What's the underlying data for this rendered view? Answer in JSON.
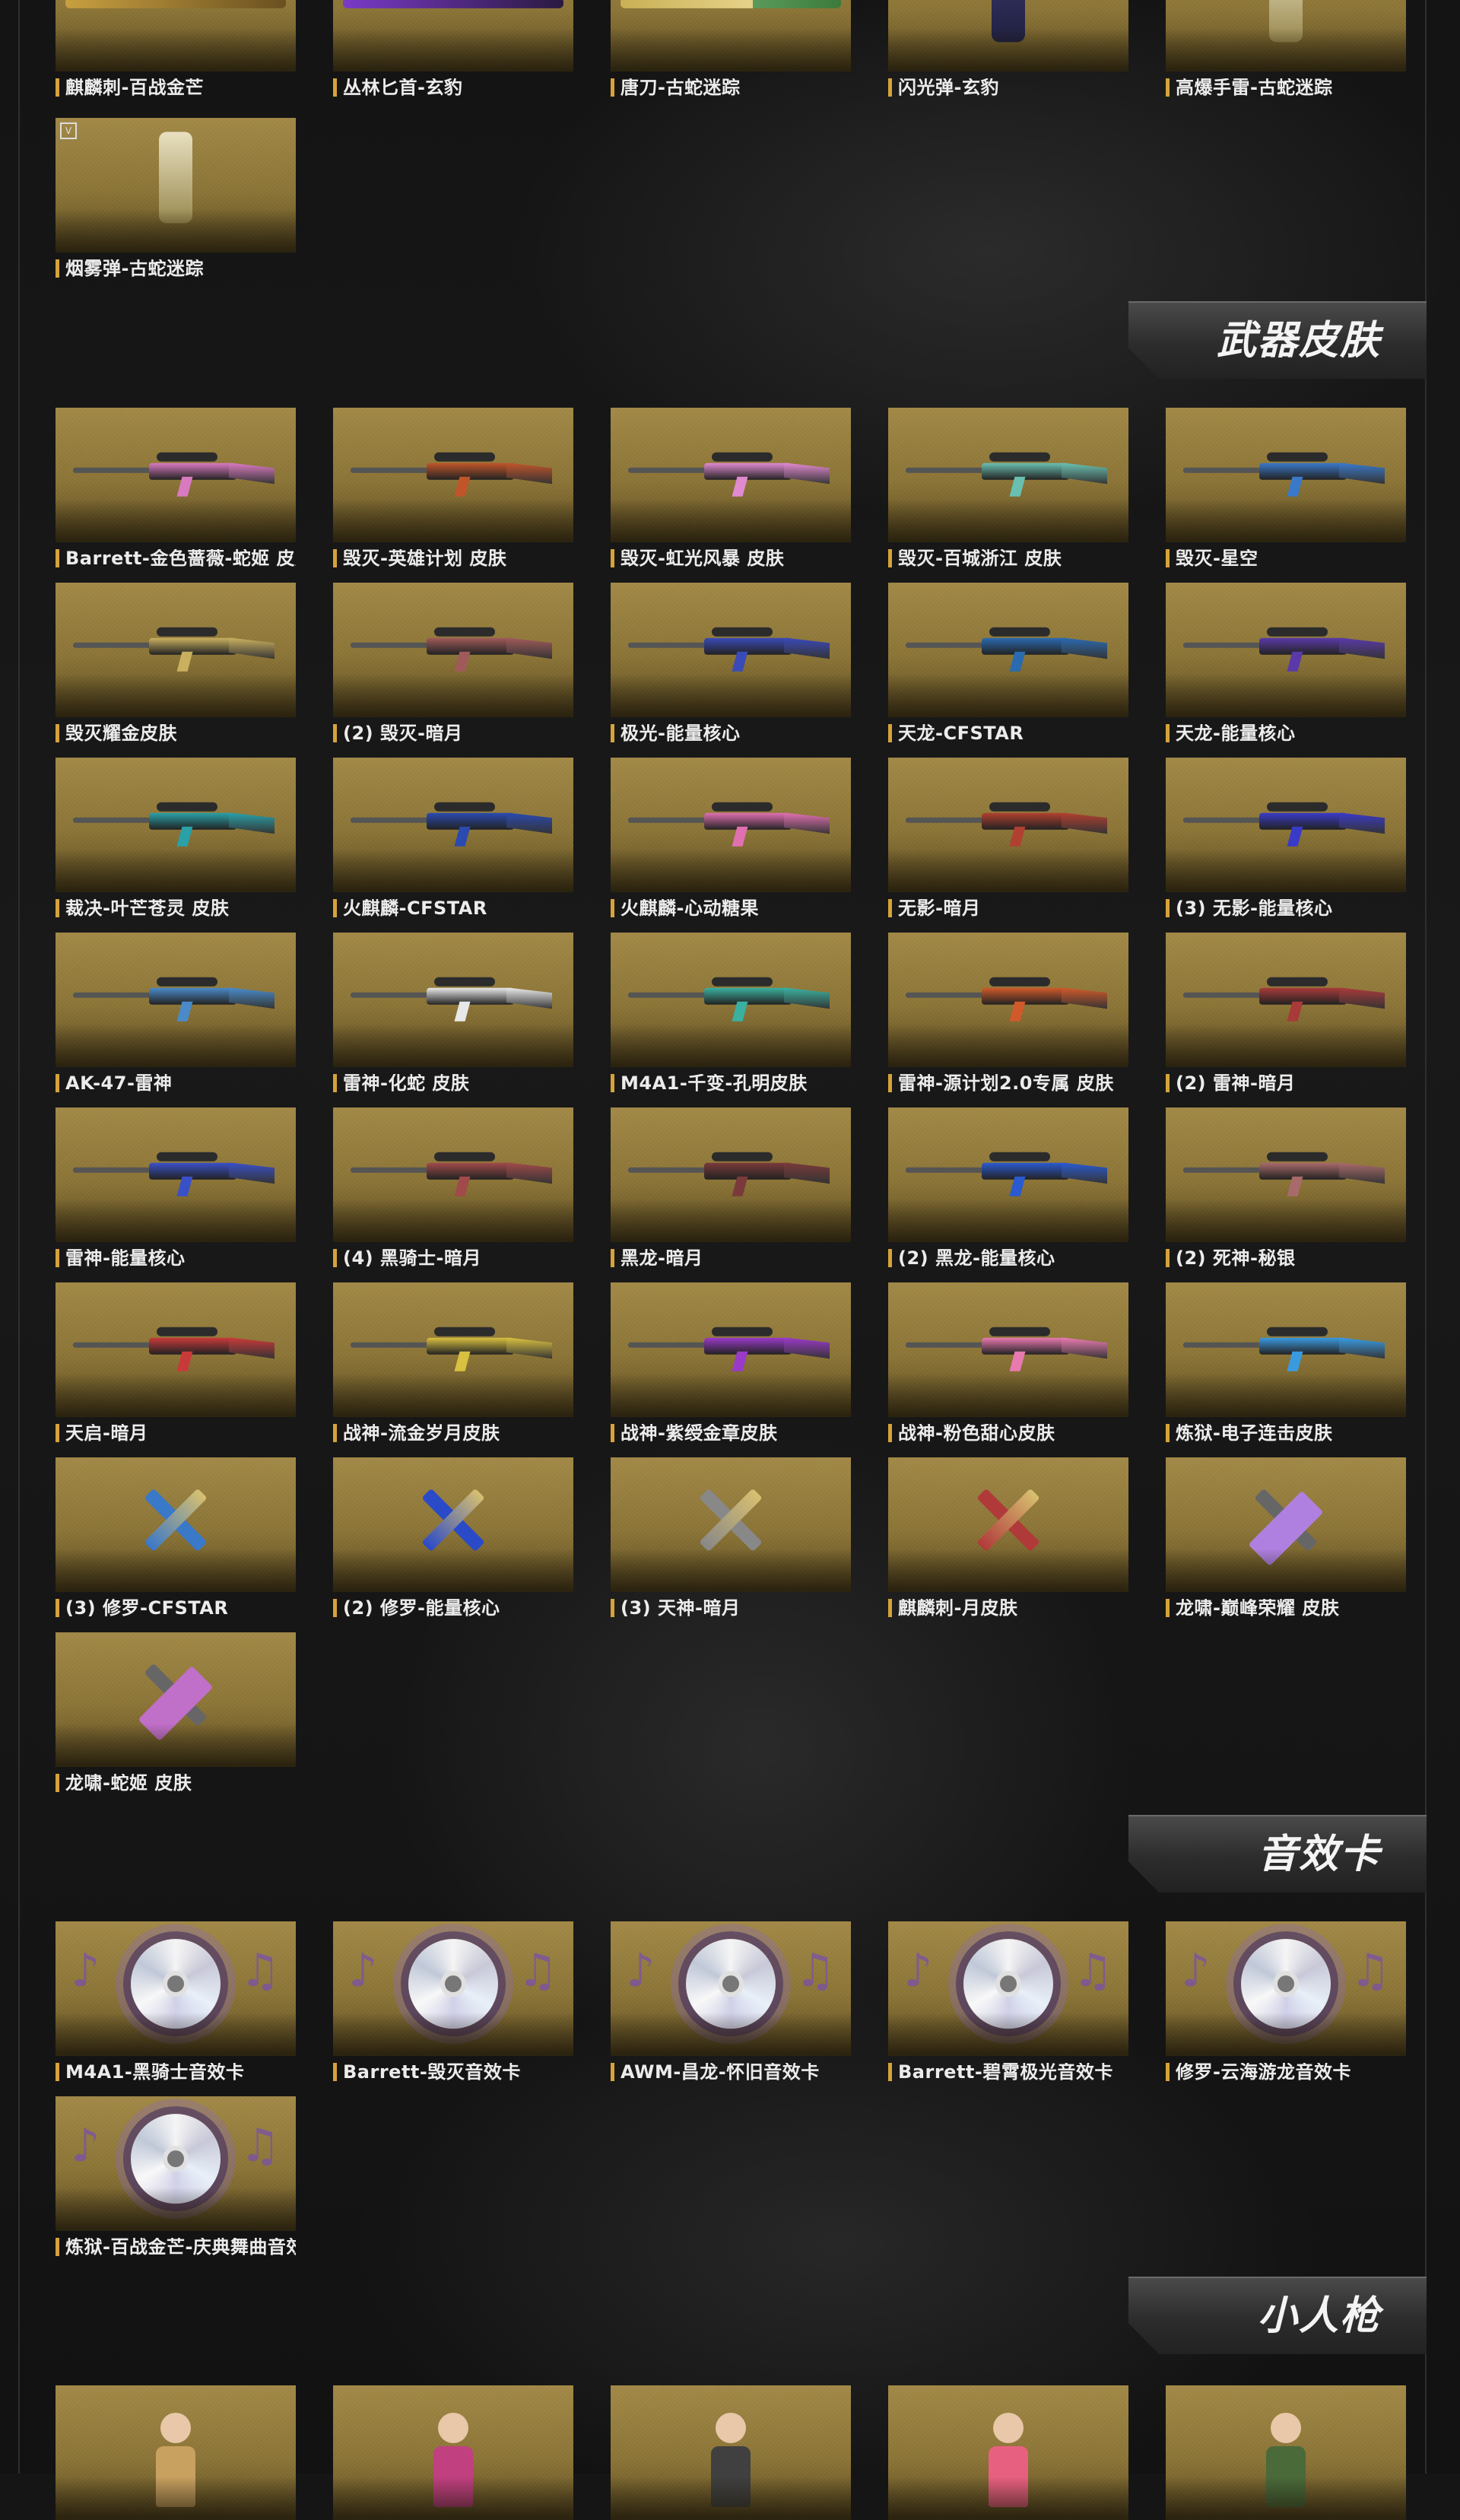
{
  "sections": {
    "weapon_skins": "武器皮肤",
    "sound_cards": "音效卡",
    "mini_guns": "小人枪"
  },
  "top_items": [
    {
      "label": "麒麟刺-百战金芒",
      "icon": "dagger-icon"
    },
    {
      "label": "丛林匕首-玄豹",
      "icon": "knife-icon"
    },
    {
      "label": "唐刀-古蛇迷踪",
      "icon": "sword-icon"
    },
    {
      "label": "闪光弹-玄豹",
      "icon": "grenade-icon"
    },
    {
      "label": "高爆手雷-古蛇迷踪",
      "icon": "grenade-icon"
    },
    {
      "label": "烟雾弹-古蛇迷踪",
      "icon": "smoke-grenade-icon",
      "badge": "V"
    }
  ],
  "weapon_skin_items": [
    {
      "label": "Barrett-金色蔷薇-蛇姬 皮肤",
      "color": "#d97ac0"
    },
    {
      "label": "毁灭-英雄计划 皮肤",
      "color": "#c0552a"
    },
    {
      "label": "毁灭-虹光风暴 皮肤",
      "color": "#e08ad0"
    },
    {
      "label": "毁灭-百城浙江 皮肤",
      "color": "#6ac0b0"
    },
    {
      "label": "毁灭-星空",
      "color": "#3a78c8"
    },
    {
      "label": "毁灭耀金皮肤",
      "color": "#c9b060"
    },
    {
      "label": "(2) 毁灭-暗月",
      "color": "#a05a5a"
    },
    {
      "label": "极光-能量核心",
      "color": "#3a4ab8"
    },
    {
      "label": "天龙-CFSTAR",
      "color": "#2a6ab0"
    },
    {
      "label": "天龙-能量核心",
      "color": "#5a3aa8"
    },
    {
      "label": "裁决-叶芒苍灵 皮肤",
      "color": "#2aa0a8"
    },
    {
      "label": "火麒麟-CFSTAR",
      "color": "#2a4ab0"
    },
    {
      "label": "火麒麟-心动糖果",
      "color": "#e070b0"
    },
    {
      "label": "无影-暗月",
      "color": "#b04030"
    },
    {
      "label": "(3) 无影-能量核心",
      "color": "#3a3ac8"
    },
    {
      "label": "AK-47-雷神",
      "color": "#4a8ac8"
    },
    {
      "label": "雷神-化蛇 皮肤",
      "color": "#e8e8e8"
    },
    {
      "label": "M4A1-千变-孔明皮肤",
      "color": "#3ab0a0"
    },
    {
      "label": "雷神-源计划2.0专属 皮肤",
      "color": "#d05a2a"
    },
    {
      "label": "(2) 雷神-暗月",
      "color": "#a83a3a"
    },
    {
      "label": "雷神-能量核心",
      "color": "#3a50c8"
    },
    {
      "label": "(4) 黑骑士-暗月",
      "color": "#a04a4a"
    },
    {
      "label": "黑龙-暗月",
      "color": "#7a3a3a"
    },
    {
      "label": "(2) 黑龙-能量核心",
      "color": "#2a5ad0"
    },
    {
      "label": "(2) 死神-秘银",
      "color": "#a86a6a"
    },
    {
      "label": "天启-暗月",
      "color": "#c83a3a"
    },
    {
      "label": "战神-流金岁月皮肤",
      "color": "#d8c040"
    },
    {
      "label": "战神-紫绶金章皮肤",
      "color": "#9a3ac8"
    },
    {
      "label": "战神-粉色甜心皮肤",
      "color": "#e87ab0"
    },
    {
      "label": "炼狱-电子连击皮肤",
      "color": "#3a9ae0"
    },
    {
      "label": "(3) 修罗-CFSTAR",
      "color": "#3a78c8"
    },
    {
      "label": "(2) 修罗-能量核心",
      "color": "#2a4ac8"
    },
    {
      "label": "(3) 天神-暗月",
      "color": "#888888"
    },
    {
      "label": "麒麟刺-月皮肤",
      "color": "#b03a3a"
    },
    {
      "label": "龙啸-巅峰荣耀 皮肤",
      "color": "#b080e0"
    },
    {
      "label": "龙啸-蛇姬 皮肤",
      "color": "#c070c8"
    }
  ],
  "sound_card_items": [
    {
      "label": "M4A1-黑骑士音效卡"
    },
    {
      "label": "Barrett-毁灭音效卡"
    },
    {
      "label": "AWM-昌龙-怀旧音效卡"
    },
    {
      "label": "Barrett-碧霄极光音效卡"
    },
    {
      "label": "修罗-云海游龙音效卡"
    },
    {
      "label": "炼狱-百战金芒-庆典舞曲音效卡"
    }
  ],
  "mini_gun_items": [
    {
      "color": "#c8a060"
    },
    {
      "color": "#c04080"
    },
    {
      "color": "#404040"
    },
    {
      "color": "#e86080"
    },
    {
      "color": "#4a6a3a"
    }
  ]
}
